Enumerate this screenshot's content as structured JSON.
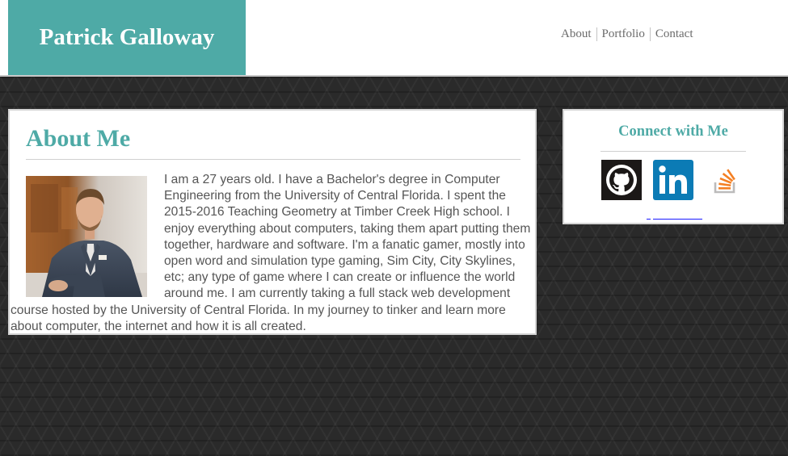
{
  "header": {
    "brand": "Patrick Galloway",
    "nav": [
      {
        "label": "About"
      },
      {
        "label": "Portfolio"
      },
      {
        "label": "Contact"
      }
    ]
  },
  "about": {
    "title": "About Me",
    "photo_alt": "Portrait of Patrick Galloway in a grey suit",
    "bio": "I am a 27 years old. I have a Bachelor's degree in Computer Engineering from the University of Central Florida. I spent the 2015-2016 Teaching Geometry at Timber Creek High school. I enjoy everything about computers, taking them apart putting them together, hardware and software. I'm a fanatic gamer, mostly into open word and simulation type gaming, Sim City, City Skylines, etc; any type of game where I can create or influence the world around me. I am currently taking a full stack web development course hosted by the University of Central Florida. In my journey to tinker and learn more about computer, the internet and how it is all created."
  },
  "connect": {
    "title": "Connect with Me",
    "links": [
      {
        "icon": "github-icon"
      },
      {
        "icon": "linkedin-icon"
      },
      {
        "icon": "stackoverflow-icon"
      }
    ]
  },
  "colors": {
    "accent": "#4eaaa6",
    "background": "#2a2a2a",
    "text": "#555555"
  }
}
